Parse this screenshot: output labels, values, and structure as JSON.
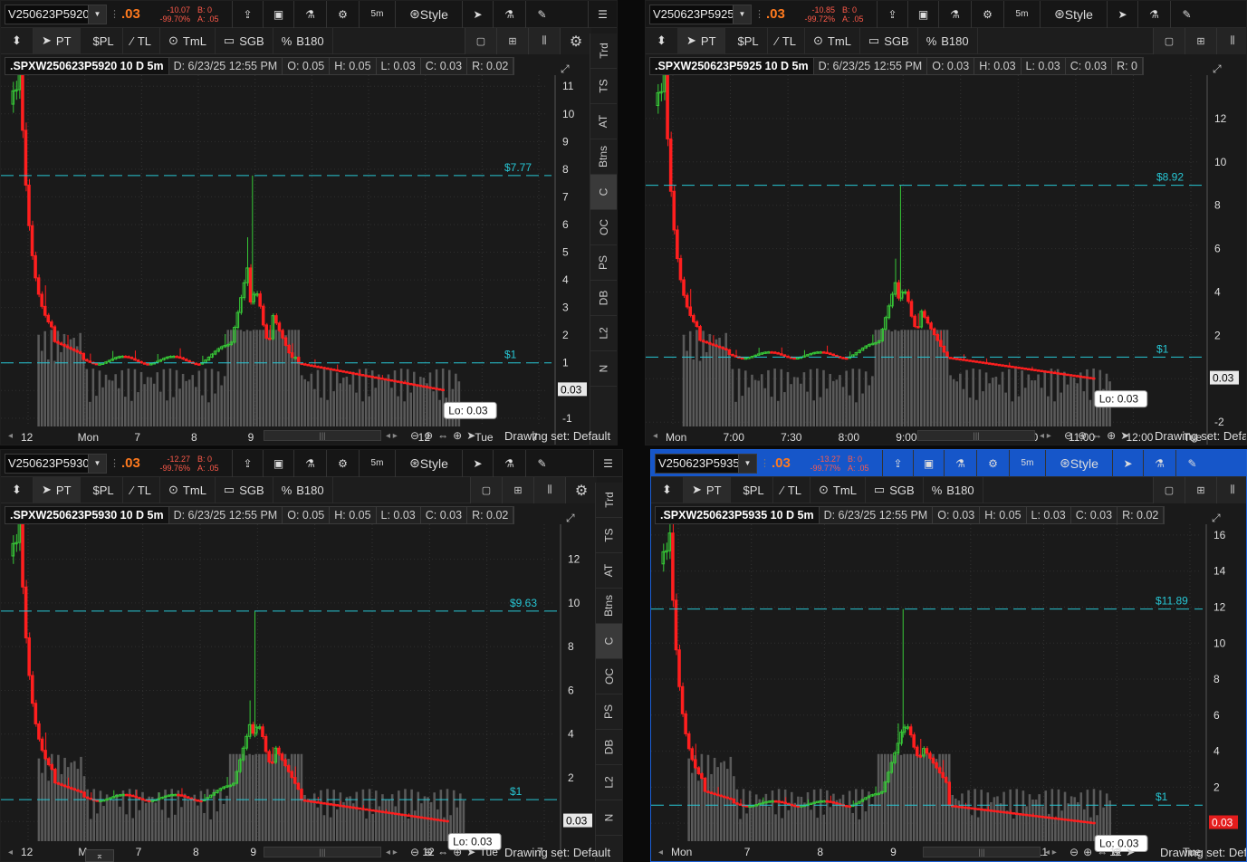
{
  "colors": {
    "accent_blue": "#1656c9",
    "price_down": "#ff7a1e",
    "cyan": "#27c6d4",
    "candle_up": "#37c837",
    "candle_down": "#ff1f1f",
    "volume": "#5a5a5a"
  },
  "toolbar": {
    "style_label": "Style",
    "timeframe": "5m"
  },
  "drawing_tools": {
    "pt": "PT",
    "pl": "$PL",
    "tl": "TL",
    "tml": "TmL",
    "sgb": "SGB",
    "b180": "B180"
  },
  "side_tabs": [
    "Trd",
    "TS",
    "AT",
    "Btns",
    "C",
    "OC",
    "PS",
    "DB",
    "L2",
    "N"
  ],
  "status": {
    "drawing_set": "Drawing set: Default",
    "drawing_set_cut": "Drawing set: Defa"
  },
  "panes": [
    {
      "symbol_field": "V250623P5920",
      "last": ".03",
      "net_change": "-10.07",
      "pct_change": "-99.70%",
      "bid": "B: 0",
      "ask": "A: .05",
      "info": {
        "symbol": ".SPXW250623P5920 10 D 5m",
        "date": "D: 6/23/25 12:55 PM",
        "open": "O: 0.05",
        "high": "H: 0.05",
        "low": "L: 0.03",
        "close": "C: 0.03",
        "range": "R: 0.02"
      },
      "chart_data": {
        "type": "candlestick",
        "price_axis_ticks": [
          "11",
          "10",
          "9",
          "8",
          "7",
          "6",
          "5",
          "4",
          "3",
          "2",
          "1",
          "0",
          "-1"
        ],
        "ylim": [
          -1.3,
          11.4
        ],
        "time_labels": [
          "12",
          "Mon",
          "7",
          "8",
          "9",
          "10",
          "11",
          "12",
          "Tue",
          "7"
        ],
        "price_lines": [
          {
            "label": "$7.77",
            "value": 7.77
          },
          {
            "label": "$1",
            "value": 1.0
          }
        ],
        "last_price_tag": "0.03",
        "low_label": "Lo: 0.03",
        "series_peak": 7.77,
        "open_spike": 11.5,
        "spike_at_9_45": 7.77,
        "close": 0.03
      }
    },
    {
      "symbol_field": "V250623P5925",
      "last": ".03",
      "net_change": "-10.85",
      "pct_change": "-99.72%",
      "bid": "B: 0",
      "ask": "A: .05",
      "info": {
        "symbol": ".SPXW250623P5925 10 D 5m",
        "date": "D: 6/23/25 12:55 PM",
        "open": "O: 0.03",
        "high": "H: 0.03",
        "low": "L: 0.03",
        "close": "C: 0.03",
        "range": "R: 0"
      },
      "chart_data": {
        "type": "candlestick",
        "price_axis_ticks": [
          "12",
          "10",
          "8",
          "6",
          "4",
          "2",
          "0",
          "-2"
        ],
        "ylim": [
          -2.2,
          14.0
        ],
        "time_labels": [
          "Mon",
          "7:00",
          "7:30",
          "8:00",
          "9:00",
          "9:30",
          "10:00",
          "11:00",
          "12:00",
          "Tue"
        ],
        "price_lines": [
          {
            "label": "$8.92",
            "value": 8.92
          },
          {
            "label": "$1",
            "value": 1.0
          }
        ],
        "last_price_tag": "0.03",
        "low_label": "Lo: 0.03",
        "open_spike": 14.0,
        "spike_at_9_45": 8.92,
        "close": 0.03
      }
    },
    {
      "symbol_field": "V250623P5930",
      "last": ".03",
      "net_change": "-12.27",
      "pct_change": "-99.76%",
      "bid": "B: 0",
      "ask": "A: .05",
      "info": {
        "symbol": ".SPXW250623P5930 10 D 5m",
        "date": "D: 6/23/25 12:55 PM",
        "open": "O: 0.05",
        "high": "H: 0.05",
        "low": "L: 0.03",
        "close": "C: 0.03",
        "range": "R: 0.02"
      },
      "chart_data": {
        "type": "candlestick",
        "price_axis_ticks": [
          "12",
          "10",
          "8",
          "6",
          "4",
          "2",
          "0"
        ],
        "ylim": [
          -0.9,
          13.6
        ],
        "time_labels": [
          "12",
          "Mon",
          "7",
          "8",
          "9",
          "10",
          "11",
          "12",
          "Tue",
          "7"
        ],
        "price_lines": [
          {
            "label": "$9.63",
            "value": 9.63
          },
          {
            "label": "$1",
            "value": 1.0
          }
        ],
        "last_price_tag": "0.03",
        "low_label": "Lo: 0.03",
        "open_spike": 13.5,
        "spike_at_9_45": 9.63,
        "close": 0.03
      }
    },
    {
      "symbol_field": "V250623P5935",
      "last": ".03",
      "net_change": "-13.27",
      "pct_change": "-99.77%",
      "bid": "B: 0",
      "ask": "A: .05",
      "info": {
        "symbol": ".SPXW250623P5935 10 D 5m",
        "date": "D: 6/23/25 12:55 PM",
        "open": "O: 0.03",
        "high": "H: 0.05",
        "low": "L: 0.03",
        "close": "C: 0.03",
        "range": "R: 0.02"
      },
      "chart_data": {
        "type": "candlestick",
        "price_axis_ticks": [
          "16",
          "14",
          "12",
          "10",
          "8",
          "6",
          "4",
          "2",
          "0"
        ],
        "ylim": [
          -1.0,
          16.6
        ],
        "time_labels": [
          "Mon",
          "7",
          "8",
          "9",
          "10",
          "11",
          "12",
          "Tue"
        ],
        "price_lines": [
          {
            "label": "$11.89",
            "value": 11.89
          },
          {
            "label": "$1",
            "value": 1.0
          }
        ],
        "last_price_tag": "0.03",
        "low_label": "Lo: 0.03",
        "open_spike": 16.0,
        "spike_at_9_45": 11.89,
        "close": 0.03
      }
    }
  ]
}
